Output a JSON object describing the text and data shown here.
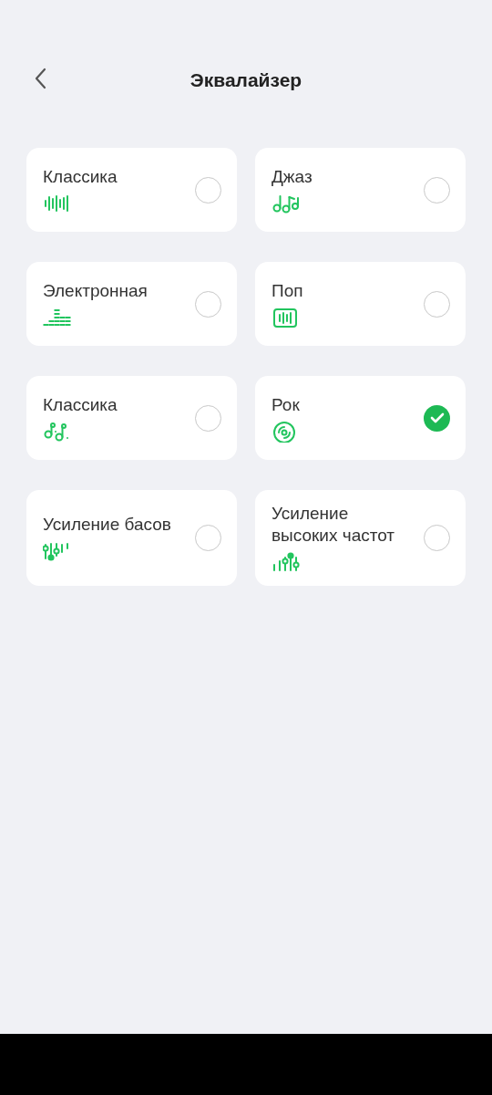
{
  "header": {
    "title": "Эквалайзер"
  },
  "presets": [
    {
      "label": "Классика",
      "kind": "wave",
      "selected": false
    },
    {
      "label": "Джаз",
      "kind": "notes",
      "selected": false
    },
    {
      "label": "Электронная",
      "kind": "bars",
      "selected": false
    },
    {
      "label": "Поп",
      "kind": "framed-wave",
      "selected": false
    },
    {
      "label": "Классика",
      "kind": "notes-dotted",
      "selected": false
    },
    {
      "label": "Рок",
      "kind": "disc",
      "selected": true
    },
    {
      "label": "Усиление басов",
      "kind": "bass-sliders",
      "selected": false
    },
    {
      "label": "Усиление высоких частот",
      "kind": "treble-sliders",
      "selected": false
    }
  ]
}
